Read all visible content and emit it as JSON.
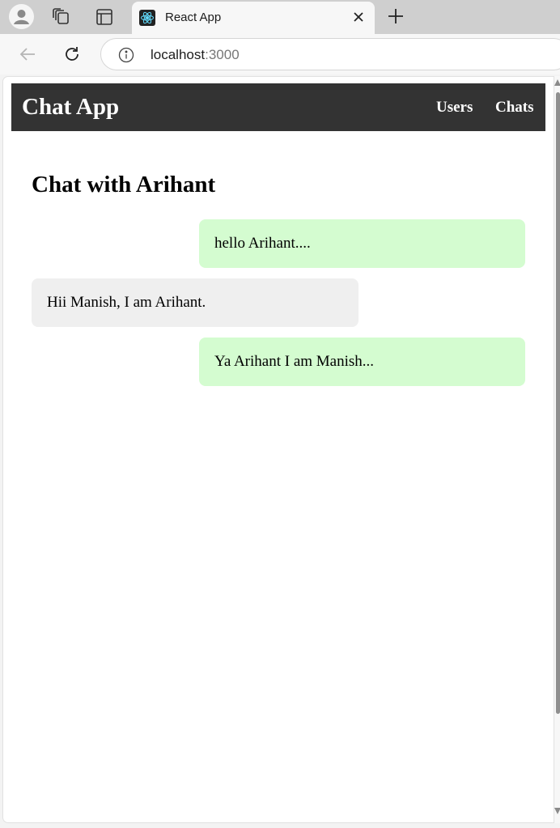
{
  "browser": {
    "tab": {
      "title": "React App",
      "favicon": "react-icon"
    },
    "address": {
      "host": "localhost",
      "port": ":3000"
    },
    "icons": {
      "profile": "profile-icon",
      "workspaces": "workspaces-icon",
      "tab_actions": "tab-actions-icon",
      "close": "close-icon",
      "new_tab": "plus-icon",
      "back": "back-arrow-icon",
      "reload": "reload-icon",
      "info": "info-icon"
    }
  },
  "app": {
    "title": "Chat App",
    "nav": [
      {
        "label": "Users"
      },
      {
        "label": "Chats"
      }
    ]
  },
  "chat": {
    "heading": "Chat with Arihant",
    "messages": [
      {
        "text": "hello Arihant....",
        "direction": "sent"
      },
      {
        "text": "Hii Manish, I am Arihant.",
        "direction": "received"
      },
      {
        "text": "Ya Arihant I am Manish...",
        "direction": "sent"
      }
    ]
  },
  "colors": {
    "header_bg": "#333333",
    "sent_bubble": "#d4fcd0",
    "received_bubble": "#efefef"
  }
}
